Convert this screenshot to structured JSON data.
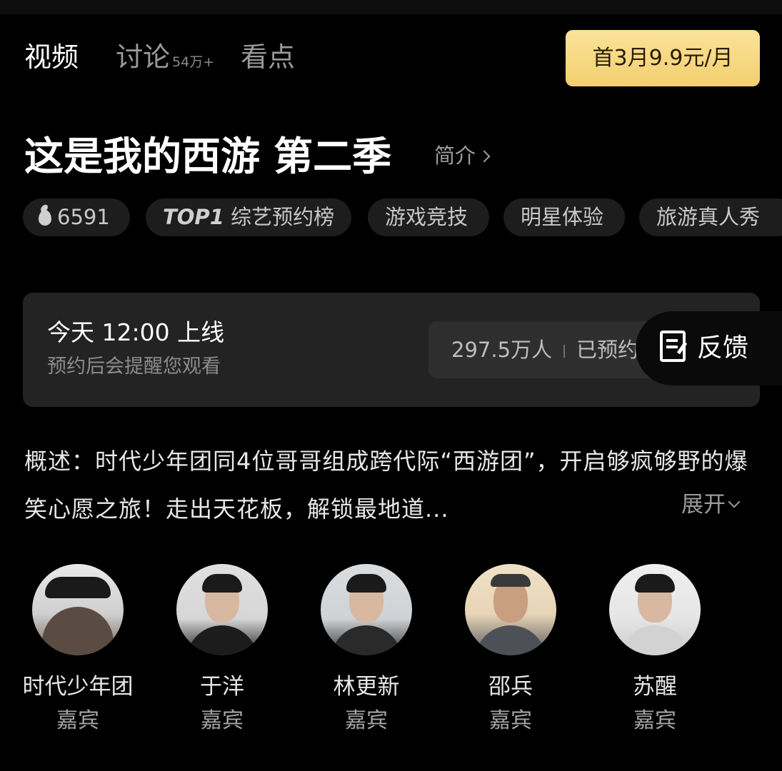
{
  "tabs": {
    "video": "视频",
    "discuss": "讨论",
    "discuss_count": "54万+",
    "highlights": "看点"
  },
  "vip_button": "首3月9.9元/月",
  "show": {
    "title": "这是我的西游 第二季",
    "intro_link": "简介"
  },
  "tags": {
    "hot_count": "6591",
    "rank_top": "TOP1",
    "rank_label": "综艺预约榜",
    "genre_1": "游戏竞技",
    "genre_2": "明星体验",
    "genre_3": "旅游真人秀"
  },
  "reservation": {
    "launch_time": "今天 12:00 上线",
    "remind_text": "预约后会提醒您观看",
    "reserved_count": "297.5万人",
    "reserved_status": "已预约"
  },
  "feedback_label": "反馈",
  "synopsis": {
    "text": "概述：时代少年团同4位哥哥组成跨代际“西游团”，开启够疯够野的爆笑心愿之旅！走出天花板，解锁最地道...",
    "expand_label": "展开"
  },
  "cast": [
    {
      "name": "时代少年团",
      "role": "嘉宾"
    },
    {
      "name": "于洋",
      "role": "嘉宾"
    },
    {
      "name": "林更新",
      "role": "嘉宾"
    },
    {
      "name": "邵兵",
      "role": "嘉宾"
    },
    {
      "name": "苏醒",
      "role": "嘉宾"
    }
  ],
  "colors": {
    "background": "#000000",
    "vip_gold": "#f5d47a",
    "card_bg": "#232323",
    "tag_bg": "#1d1d1d"
  }
}
